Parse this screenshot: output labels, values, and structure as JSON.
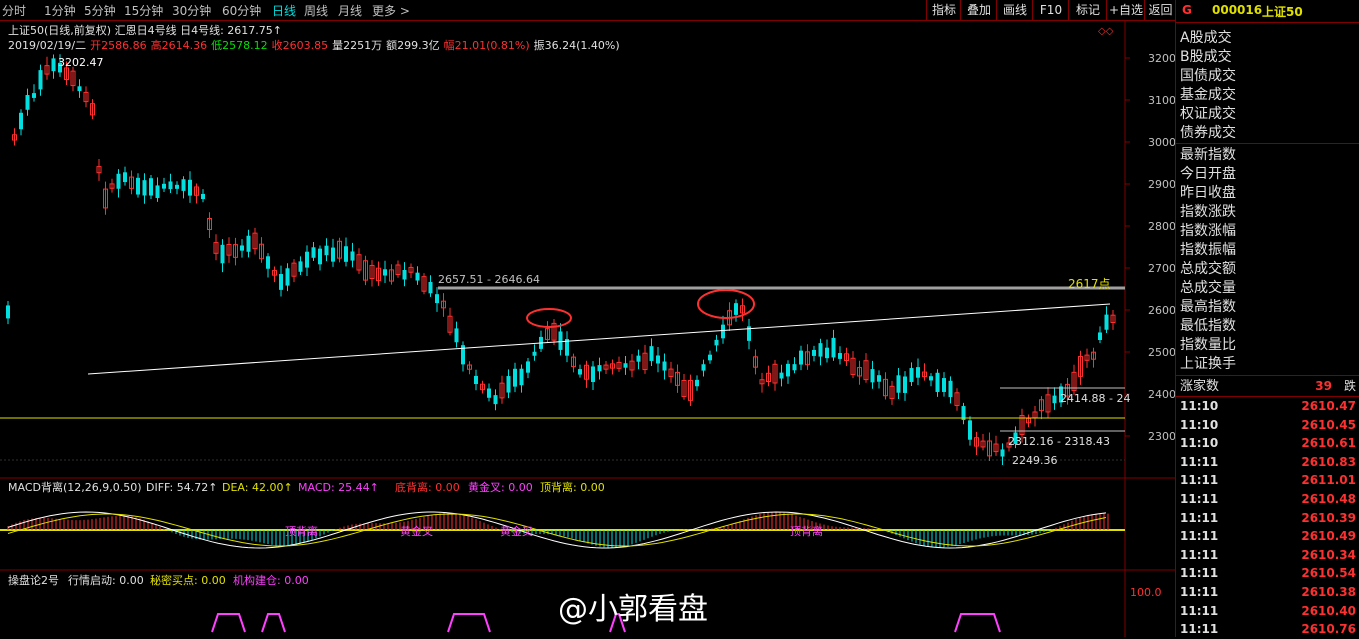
{
  "toolbar": {
    "periods": [
      "分时",
      "1分钟",
      "5分钟",
      "15分钟",
      "30分钟",
      "60分钟",
      "日线",
      "周线",
      "月线",
      "更多 >"
    ],
    "active_period": "日线",
    "right_buttons": [
      "指标",
      "叠加",
      "画线",
      "F10",
      "标记",
      "+自选",
      "返回"
    ]
  },
  "header": {
    "title_line": "上证50(日线,前复权) 汇恩日4号线 日4号线: 2617.75↑",
    "date": "2019/02/19/二",
    "open_label": "开",
    "open": "2586.86",
    "high_label": "高",
    "high": "2614.36",
    "low_label": "低",
    "low": "2578.12",
    "close_label": "收",
    "close": "2603.85",
    "volume_label": "量",
    "volume": "2251万",
    "amount_label": "额",
    "amount": "299.3亿",
    "change_label": "幅",
    "change": "21.01(0.81%)",
    "amplitude_label": "振",
    "amplitude": "36.24(1.40%)"
  },
  "price_axis": [
    "3200",
    "3100",
    "3000",
    "2900",
    "2800",
    "2700",
    "2600",
    "2500",
    "2400",
    "2300"
  ],
  "annotations": {
    "peak": "3202.47",
    "resistance_zone": "2657.51 - 2646.64",
    "level_2617": "2617点",
    "level_a": "2414.88 - 24",
    "level_b": "2312.16 - 2318.43",
    "low": "2249.36"
  },
  "macd_panel": {
    "name": "MACD背离(12,26,9,0.50)",
    "diff": "DIFF: 54.72↑",
    "dea": "DEA: 42.00↑",
    "macd": "MACD: 25.44↑",
    "bottom_div": "底背离: 0.00",
    "golden_cross": "黄金叉: 0.00",
    "top_div": "顶背离: 0.00",
    "chart_labels": [
      "顶背离",
      "黄金叉",
      "黄金叉",
      "顶背离"
    ]
  },
  "third_panel": {
    "name": "操盘论2号",
    "start": "行情启动: 0.00",
    "secret": "秘密买点: 0.00",
    "build": "机构建仓: 0.00",
    "axis": "100.0"
  },
  "watermark": "@小郭看盘",
  "right_panel": {
    "marker": "G",
    "code": "000016",
    "name": "上证50",
    "menu1": [
      "A股成交",
      "B股成交",
      "国债成交",
      "基金成交",
      "权证成交",
      "债券成交"
    ],
    "menu2": [
      "最新指数",
      "今日开盘",
      "昨日收盘",
      "指数涨跌",
      "指数涨幅",
      "指数振幅",
      "总成交额",
      "总成交量",
      "最高指数",
      "最低指数",
      "指数量比",
      "上证换手"
    ],
    "stats_label": "涨家数",
    "stats_value": "39",
    "stats_right": "跌",
    "ticks": [
      {
        "t": "11:10",
        "p": "2610.47"
      },
      {
        "t": "11:10",
        "p": "2610.45"
      },
      {
        "t": "11:10",
        "p": "2610.61"
      },
      {
        "t": "11:11",
        "p": "2610.83"
      },
      {
        "t": "11:11",
        "p": "2611.01"
      },
      {
        "t": "11:11",
        "p": "2610.48"
      },
      {
        "t": "11:11",
        "p": "2610.39"
      },
      {
        "t": "11:11",
        "p": "2610.49"
      },
      {
        "t": "11:11",
        "p": "2610.34"
      },
      {
        "t": "11:11",
        "p": "2610.54"
      },
      {
        "t": "11:11",
        "p": "2610.38"
      },
      {
        "t": "11:11",
        "p": "2610.40"
      },
      {
        "t": "11:11",
        "p": "2610.76"
      }
    ]
  }
}
